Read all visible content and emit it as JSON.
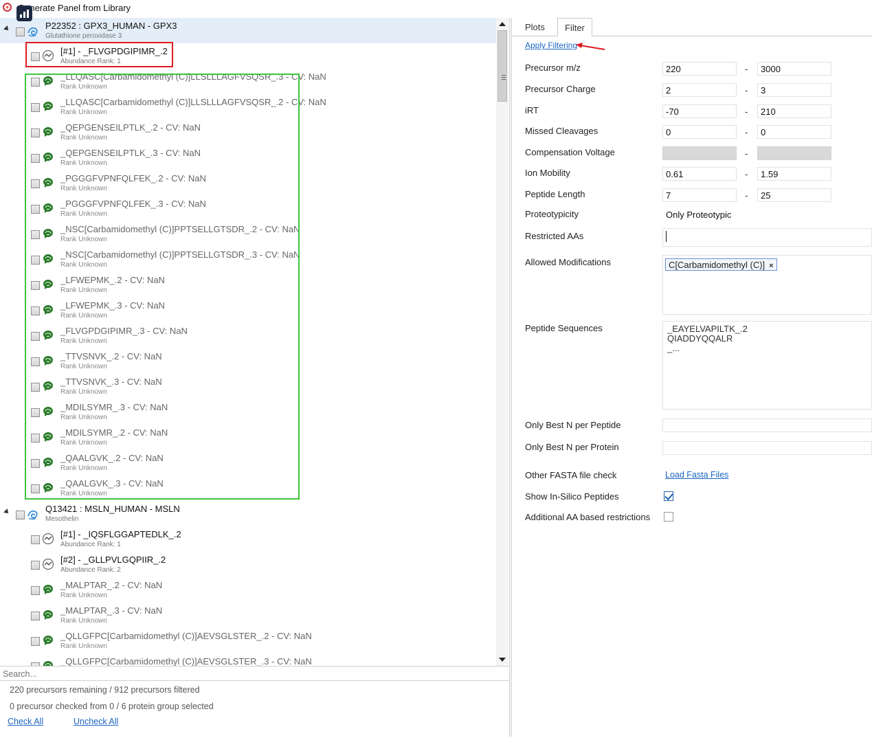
{
  "window": {
    "title": "Generate Panel from Library"
  },
  "tree": {
    "groups": [
      {
        "accession_line": "P22352 : GPX3_HUMAN - GPX3",
        "description": "Glutathione peroxidase 3",
        "peptides": [
          {
            "text": "[#1] - _FLVGPDGIPIMR_.2",
            "sub": "Abundance Rank: 1",
            "type": "ranked"
          },
          {
            "text": "_LLQASC[Carbamidomethyl (C)]LLSLLLAGFVSQSR_.3 - CV: NaN",
            "sub": "Rank Unknown",
            "type": "unranked"
          },
          {
            "text": "_LLQASC[Carbamidomethyl (C)]LLSLLLAGFVSQSR_.2 - CV: NaN",
            "sub": "Rank Unknown",
            "type": "unranked"
          },
          {
            "text": "_QEPGENSEILPTLK_.2 - CV: NaN",
            "sub": "Rank Unknown",
            "type": "unranked"
          },
          {
            "text": "_QEPGENSEILPTLK_.3 - CV: NaN",
            "sub": "Rank Unknown",
            "type": "unranked"
          },
          {
            "text": "_PGGGFVPNFQLFEK_.2 - CV: NaN",
            "sub": "Rank Unknown",
            "type": "unranked"
          },
          {
            "text": "_PGGGFVPNFQLFEK_.3 - CV: NaN",
            "sub": "Rank Unknown",
            "type": "unranked"
          },
          {
            "text": "_NSC[Carbamidomethyl (C)]PPTSELLGTSDR_.2 - CV: NaN",
            "sub": "Rank Unknown",
            "type": "unranked"
          },
          {
            "text": "_NSC[Carbamidomethyl (C)]PPTSELLGTSDR_.3 - CV: NaN",
            "sub": "Rank Unknown",
            "type": "unranked"
          },
          {
            "text": "_LFWEPMK_.2 - CV: NaN",
            "sub": "Rank Unknown",
            "type": "unranked"
          },
          {
            "text": "_LFWEPMK_.3 - CV: NaN",
            "sub": "Rank Unknown",
            "type": "unranked"
          },
          {
            "text": "_FLVGPDGIPIMR_.3 - CV: NaN",
            "sub": "Rank Unknown",
            "type": "unranked"
          },
          {
            "text": "_TTVSNVK_.2 - CV: NaN",
            "sub": "Rank Unknown",
            "type": "unranked"
          },
          {
            "text": "_TTVSNVK_.3 - CV: NaN",
            "sub": "Rank Unknown",
            "type": "unranked"
          },
          {
            "text": "_MDILSYMR_.3 - CV: NaN",
            "sub": "Rank Unknown",
            "type": "unranked"
          },
          {
            "text": "_MDILSYMR_.2 - CV: NaN",
            "sub": "Rank Unknown",
            "type": "unranked"
          },
          {
            "text": "_QAALGVK_.2 - CV: NaN",
            "sub": "Rank Unknown",
            "type": "unranked"
          },
          {
            "text": "_QAALGVK_.3 - CV: NaN",
            "sub": "Rank Unknown",
            "type": "unranked"
          }
        ]
      },
      {
        "accession_line": "Q13421 : MSLN_HUMAN - MSLN",
        "description": "Mesothelin",
        "peptides": [
          {
            "text": "[#1] - _IQSFLGGAPTEDLK_.2",
            "sub": "Abundance Rank: 1",
            "type": "ranked"
          },
          {
            "text": "[#2] - _GLLPVLGQPIIR_.2",
            "sub": "Abundance Rank: 2",
            "type": "ranked"
          },
          {
            "text": "_MALPTAR_.2 - CV: NaN",
            "sub": "Rank Unknown",
            "type": "unranked"
          },
          {
            "text": "_MALPTAR_.3 - CV: NaN",
            "sub": "Rank Unknown",
            "type": "unranked"
          },
          {
            "text": "_QLLGFPC[Carbamidomethyl (C)]AEVSGLSTER_.2 - CV: NaN",
            "sub": "Rank Unknown",
            "type": "unranked"
          },
          {
            "text": "_QLLGFPC[Carbamidomethyl (C)]AEVSGLSTER_.3 - CV: NaN",
            "sub": "",
            "type": "unranked"
          }
        ]
      }
    ]
  },
  "search": {
    "placeholder": "Search..."
  },
  "status": {
    "precursors": "220 precursors remaining / 912 precursors filtered",
    "checked": "0 precursor checked from 0 / 6 protein group selected",
    "check_all": "Check All",
    "uncheck_all": "Uncheck All"
  },
  "tabs": {
    "plots": "Plots",
    "filter": "Filter"
  },
  "filter": {
    "apply": "Apply Filtering",
    "range_rows": [
      {
        "label": "Precursor m/z",
        "min": "220",
        "max": "3000"
      },
      {
        "label": "Precursor Charge",
        "min": "2",
        "max": "3"
      },
      {
        "label": "iRT",
        "min": "-70",
        "max": "210"
      },
      {
        "label": "Missed Cleavages",
        "min": "0",
        "max": "0"
      },
      {
        "label": "Compensation Voltage",
        "min": "",
        "max": ""
      },
      {
        "label": "Ion Mobility",
        "min": "0.61",
        "max": "1.59"
      },
      {
        "label": "Peptide Length",
        "min": "7",
        "max": "25"
      }
    ],
    "range_separator": "-",
    "proteotypicity": {
      "label": "Proteotypicity",
      "value": "Only Proteotypic"
    },
    "restricted_aas": {
      "label": "Restricted AAs",
      "value": ""
    },
    "allowed_mods": {
      "label": "Allowed Modifications",
      "tag": "C[Carbamidomethyl (C)]",
      "remove": "×"
    },
    "peptide_sequences": {
      "label": "Peptide Sequences",
      "lines": [
        "_EAYELVAPILTK_.2",
        "QIADDYQQALR",
        "_..."
      ]
    },
    "best_n_peptide": {
      "label": "Only Best N per Peptide",
      "value": ""
    },
    "best_n_protein": {
      "label": "Only Best N per Protein",
      "value": ""
    },
    "fasta": {
      "label": "Other FASTA file check",
      "link": "Load Fasta Files"
    },
    "insilico": {
      "label": "Show In-Silico Peptides",
      "checked": true
    },
    "aa_restrict": {
      "label": "Additional AA based restrictions",
      "checked": false
    }
  }
}
